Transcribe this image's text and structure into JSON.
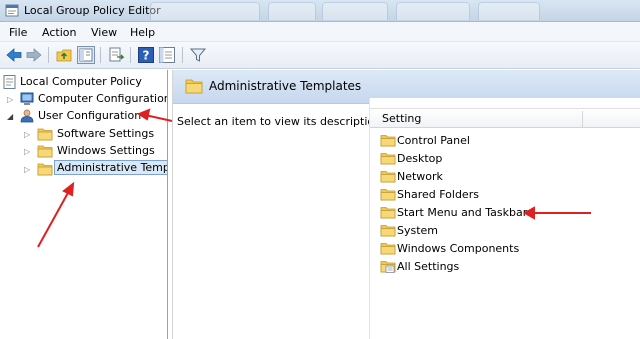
{
  "window": {
    "title": "Local Group Policy Editor"
  },
  "menubar": {
    "items": [
      "File",
      "Action",
      "View",
      "Help"
    ]
  },
  "toolbar": {
    "buttons": [
      "back-icon",
      "forward-icon",
      "up-folder-icon",
      "show-hide-tree-icon",
      "export-list-icon",
      "help-icon",
      "properties-icon",
      "filter-icon"
    ]
  },
  "tree": {
    "root": "Local Computer Policy",
    "items": [
      {
        "label": "Computer Configuration",
        "icon": "computer-icon"
      },
      {
        "label": "User Configuration",
        "icon": "user-icon"
      },
      {
        "label": "Software Settings",
        "icon": "folder-icon"
      },
      {
        "label": "Windows Settings",
        "icon": "folder-icon"
      },
      {
        "label": "Administrative Templ",
        "icon": "folder-icon",
        "selected": true
      }
    ]
  },
  "main": {
    "header_title": "Administrative Templates",
    "description": "Select an item to view its description.",
    "column_header": "Setting",
    "items": [
      {
        "label": "Control Panel",
        "icon": "folder-icon"
      },
      {
        "label": "Desktop",
        "icon": "folder-icon"
      },
      {
        "label": "Network",
        "icon": "folder-icon"
      },
      {
        "label": "Shared Folders",
        "icon": "folder-icon"
      },
      {
        "label": "Start Menu and Taskbar",
        "icon": "folder-icon"
      },
      {
        "label": "System",
        "icon": "folder-icon"
      },
      {
        "label": "Windows Components",
        "icon": "folder-icon"
      },
      {
        "label": "All Settings",
        "icon": "settings-folder-icon"
      }
    ]
  },
  "colors": {
    "annotation_arrow": "#e02020",
    "folder": "#f2c94c",
    "selection": "#d9e8f7",
    "header_blue": "#c6d8ee"
  }
}
